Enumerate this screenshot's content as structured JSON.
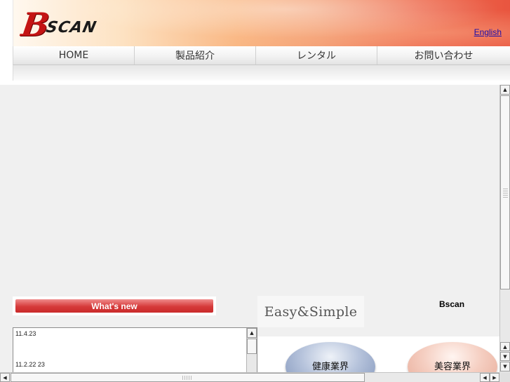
{
  "header": {
    "logo": {
      "b": "B",
      "rest": "SCAN"
    },
    "language_link": "English"
  },
  "nav": {
    "items": [
      {
        "label": "HOME"
      },
      {
        "label": "製品紹介"
      },
      {
        "label": "レンタル"
      },
      {
        "label": "お問い合わせ"
      }
    ]
  },
  "news": {
    "heading": "What's new",
    "items": [
      {
        "date": "11.4.23"
      },
      {
        "date": "11.2.22 23"
      }
    ]
  },
  "side": {
    "tagline": "Easy&Simple",
    "brand": "Bscan",
    "cards": [
      {
        "label": "健康業界"
      },
      {
        "label": "美容業界"
      }
    ]
  },
  "scrollbar": {
    "up": "▲",
    "down": "▼",
    "left": "◀",
    "right": "▶"
  }
}
